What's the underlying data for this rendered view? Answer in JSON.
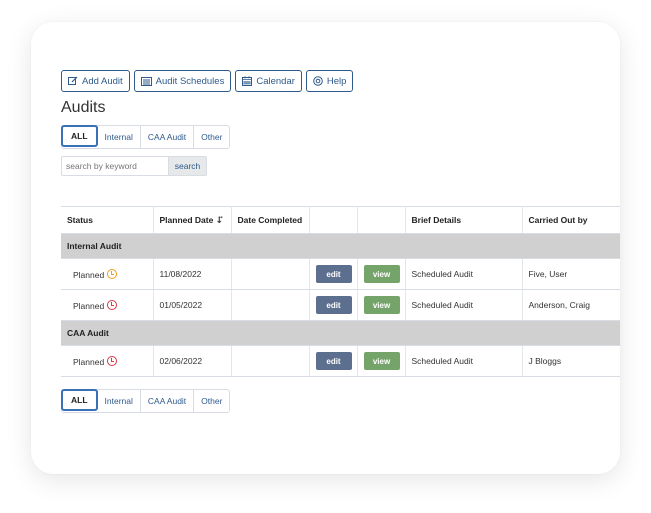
{
  "toolbar": {
    "add_audit": "Add Audit",
    "audit_schedules": "Audit Schedules",
    "calendar": "Calendar",
    "help": "Help"
  },
  "page_title": "Audits",
  "filters": [
    "ALL",
    "Internal",
    "CAA Audit",
    "Other"
  ],
  "search": {
    "placeholder": "search by keyword",
    "button": "search"
  },
  "table": {
    "headers": [
      "Status",
      "Planned Date",
      "Date Completed",
      "",
      "",
      "Brief Details",
      "Carried Out by"
    ],
    "groups": [
      {
        "name": "Internal Audit",
        "rows": [
          {
            "status": "Planned",
            "status_color": "#f0a21a",
            "planned_date": "11/08/2022",
            "date_completed": "",
            "edit": "edit",
            "view": "view",
            "details": "Scheduled Audit",
            "carried_out_by": "Five, User"
          },
          {
            "status": "Planned",
            "status_color": "#dc3545",
            "planned_date": "01/05/2022",
            "date_completed": "",
            "edit": "edit",
            "view": "view",
            "details": "Scheduled Audit",
            "carried_out_by": "Anderson, Craig"
          }
        ]
      },
      {
        "name": "CAA Audit",
        "rows": [
          {
            "status": "Planned",
            "status_color": "#dc3545",
            "planned_date": "02/06/2022",
            "date_completed": "",
            "edit": "edit",
            "view": "view",
            "details": "Scheduled Audit",
            "carried_out_by": "J Bloggs"
          }
        ]
      }
    ]
  }
}
